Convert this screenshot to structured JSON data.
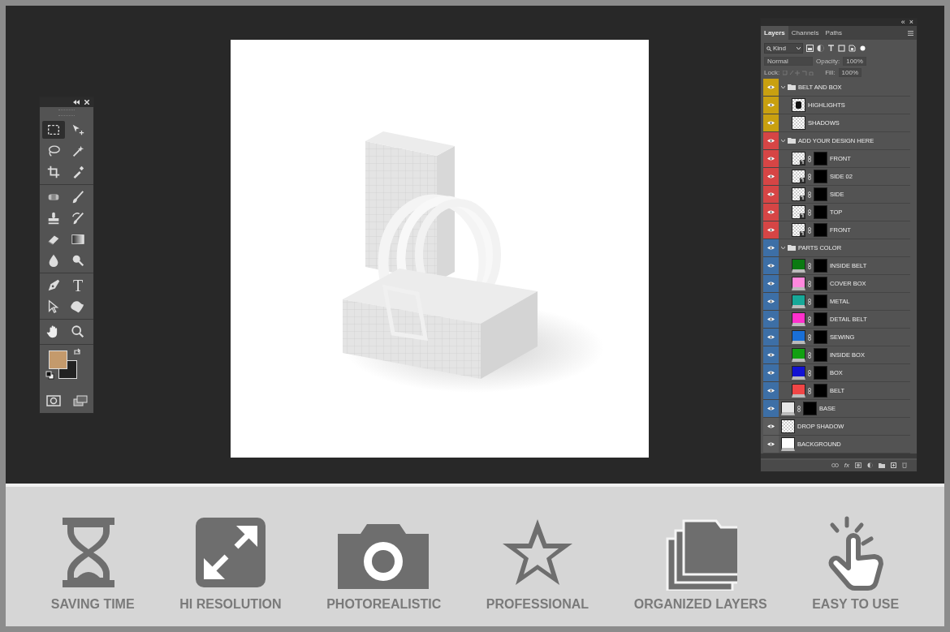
{
  "tools_panel": {
    "sections": [
      [
        {
          "kind": "marquee",
          "selected": true
        },
        {
          "kind": "move",
          "selected": false
        },
        {
          "kind": "lasso",
          "selected": false
        },
        {
          "kind": "wand",
          "selected": false
        },
        {
          "kind": "crop",
          "selected": false
        },
        {
          "kind": "eyedropper",
          "selected": false
        }
      ],
      [
        {
          "kind": "healing",
          "selected": false
        },
        {
          "kind": "brush",
          "selected": false
        },
        {
          "kind": "stamp",
          "selected": false
        },
        {
          "kind": "history",
          "selected": false
        },
        {
          "kind": "eraser",
          "selected": false
        },
        {
          "kind": "gradient",
          "selected": false
        },
        {
          "kind": "blur",
          "selected": false
        },
        {
          "kind": "dodge",
          "selected": false
        }
      ],
      [
        {
          "kind": "pen",
          "selected": false
        },
        {
          "kind": "type",
          "selected": false,
          "glyph": "T"
        },
        {
          "kind": "pointer",
          "selected": false
        },
        {
          "kind": "shape",
          "selected": false
        }
      ],
      [
        {
          "kind": "hand",
          "selected": false
        },
        {
          "kind": "zoom",
          "selected": false
        }
      ]
    ]
  },
  "canvas": {
    "kind": "mockup"
  },
  "layers_panel": {
    "collapse": "«",
    "close": "×",
    "tabs": [
      {
        "label": "Layers",
        "selected": true
      },
      {
        "label": "Channels",
        "selected": false
      },
      {
        "label": "Paths",
        "selected": false
      }
    ],
    "filter": "Kind",
    "blend_mode": "Normal",
    "opacity_label": "Opacity:",
    "opacity": "100%",
    "lock_label": "Lock:",
    "fill_label": "Fill:",
    "fill": "100%",
    "layers": [
      {
        "kind": "group",
        "name": "BELT AND BOX",
        "color": "#c9a010",
        "expanded": true,
        "children": [
          {
            "kind": "pixel",
            "name": "HIGHLIGHTS",
            "shape": true
          },
          {
            "kind": "pixel",
            "name": "SHADOWS"
          }
        ]
      },
      {
        "kind": "group",
        "name": "ADD YOUR DESIGN HERE",
        "color": "#d64545",
        "expanded": true,
        "children": [
          {
            "kind": "smart",
            "name": "FRONT"
          },
          {
            "kind": "smart",
            "name": "SIDE 02"
          },
          {
            "kind": "smart",
            "name": "SIDE"
          },
          {
            "kind": "smart",
            "name": "TOP"
          },
          {
            "kind": "smart",
            "name": "FRONT"
          }
        ]
      },
      {
        "kind": "group",
        "name": "PARTS COLOR",
        "color": "#3d6fa6",
        "expanded": true,
        "children": [
          {
            "kind": "fill",
            "name": "INSIDE BELT",
            "color": "#0b7a12"
          },
          {
            "kind": "fill",
            "name": "COVER BOX",
            "color": "#ff88dd"
          },
          {
            "kind": "fill",
            "name": "METAL",
            "color": "#17a898"
          },
          {
            "kind": "fill",
            "name": "DETAIL BELT",
            "color": "#ff30cc"
          },
          {
            "kind": "fill",
            "name": "SEWING",
            "color": "#1a6fd6"
          },
          {
            "kind": "fill",
            "name": "INSIDE BOX",
            "color": "#12a012"
          },
          {
            "kind": "fill",
            "name": "BOX",
            "color": "#1212d2"
          },
          {
            "kind": "fill",
            "name": "BELT",
            "color": "#f04646"
          }
        ]
      },
      {
        "kind": "masked",
        "name": "BASE",
        "color": "#3d6fa6"
      },
      {
        "kind": "pixel",
        "name": "DROP SHADOW"
      },
      {
        "kind": "background",
        "name": "BACKGROUND"
      }
    ],
    "footer_fx": "fx"
  },
  "features": [
    {
      "kind": "hourglass",
      "label": "SAVING TIME"
    },
    {
      "kind": "expand",
      "label": "HI RESOLUTION"
    },
    {
      "kind": "camera",
      "label": "PHOTOREALISTIC"
    },
    {
      "kind": "star",
      "label": "PROFESSIONAL"
    },
    {
      "kind": "folders",
      "label": "ORGANIZED LAYERS"
    },
    {
      "kind": "hand",
      "label": "EASY TO USE"
    }
  ]
}
